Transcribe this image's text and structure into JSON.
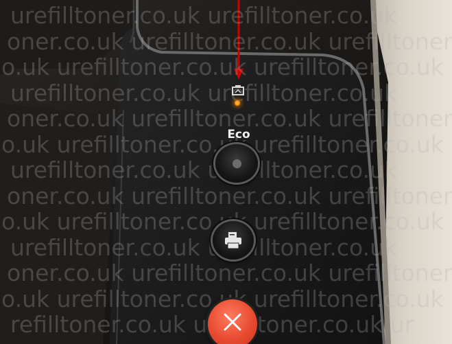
{
  "image": {
    "description_tags": [
      "printer-control-panel",
      "photo"
    ],
    "eco_label": "Eco",
    "watermark_lines": [
      "urefilltoner.co.uk urefilltoner.co.uk",
      "oner.co.uk urefilltoner.co.uk urefilltoner.co",
      "o.uk urefilltoner.co.uk urefilltoner.co.uk",
      "urefilltoner.co.uk urefilltoner.co.uk",
      "oner.co.uk urefilltoner.co.uk urefilltoner.co",
      "o.uk urefilltoner.co.uk urefilltoner.co.uk",
      "urefilltoner.co.uk urefilltoner.co.uk",
      "oner.co.uk urefilltoner.co.uk urefilltoner.co",
      "o.uk urefilltoner.co.uk urefilltoner.co.uk",
      "urefilltoner.co.uk urefilltoner.co.uk",
      "oner.co.uk urefilltoner.co.uk urefilltoner.co",
      "o.uk urefilltoner.co.uk urefilltoner.co.uk",
      "refilltoner.co.uk urefilltoner.co.uk ur"
    ],
    "colors": {
      "panel_dark": "#1a1a1a",
      "panel_frame": "#4a4a4a",
      "side_beige": "#cfc9bd",
      "arrow_red": "#cc0000",
      "led_orange": "#ff8a00",
      "cancel_orange": "#e74a2f"
    },
    "icons": [
      "toner-icon",
      "print-icon",
      "cancel-x-icon"
    ]
  }
}
